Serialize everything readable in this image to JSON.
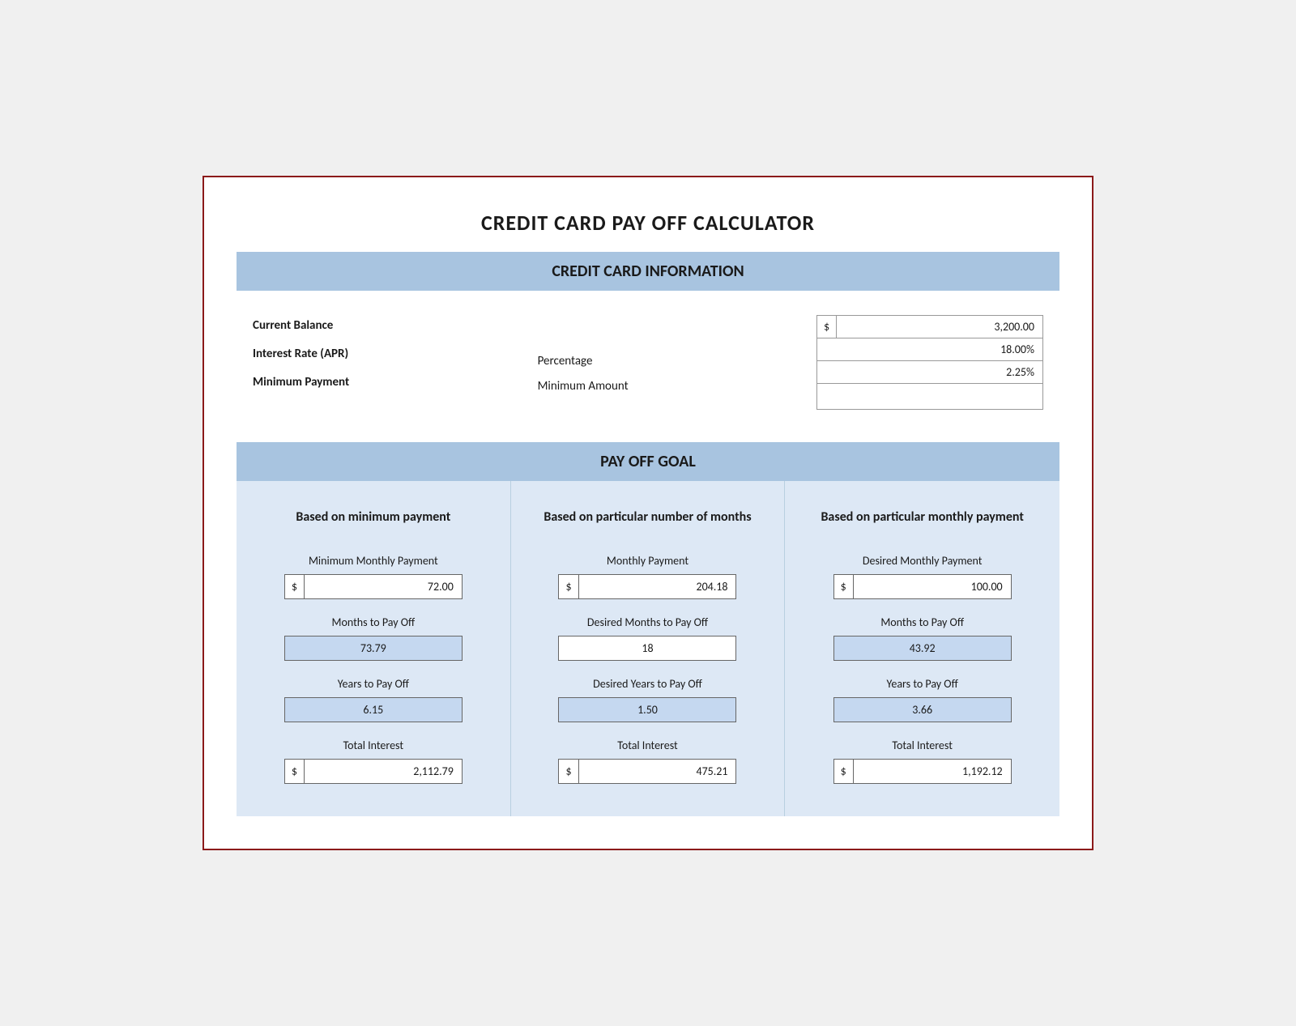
{
  "title": "CREDIT CARD PAY OFF CALCULATOR",
  "sections": {
    "cc_info": {
      "header": "CREDIT CARD INFORMATION",
      "labels": {
        "balance": "Current Balance",
        "interest": "Interest Rate (APR)",
        "minimum": "Minimum Payment"
      },
      "middle": {
        "line1": "Percentage",
        "line2": "Minimum Amount"
      },
      "values": {
        "balance_symbol": "$",
        "balance": "3,200.00",
        "interest": "18.00%",
        "percentage": "2.25%",
        "minimum_amount": ""
      }
    },
    "payoff_goal": {
      "header": "PAY OFF GOAL",
      "col1": {
        "title": "Based on minimum payment",
        "payment_label": "Minimum Monthly Payment",
        "payment_symbol": "$",
        "payment_value": "72.00",
        "months_label": "Months to Pay Off",
        "months_value": "73.79",
        "years_label": "Years to Pay Off",
        "years_value": "6.15",
        "interest_label": "Total Interest",
        "interest_symbol": "$",
        "interest_value": "2,112.79"
      },
      "col2": {
        "title": "Based on particular number of months",
        "payment_label": "Monthly Payment",
        "payment_symbol": "$",
        "payment_value": "204.18",
        "months_label": "Desired Months to Pay Off",
        "months_value": "18",
        "years_label": "Desired Years to Pay Off",
        "years_value": "1.50",
        "interest_label": "Total Interest",
        "interest_symbol": "$",
        "interest_value": "475.21"
      },
      "col3": {
        "title": "Based on particular monthly payment",
        "payment_label": "Desired Monthly Payment",
        "payment_symbol": "$",
        "payment_value": "100.00",
        "months_label": "Months to Pay Off",
        "months_value": "43.92",
        "years_label": "Years to Pay Off",
        "years_value": "3.66",
        "interest_label": "Total Interest",
        "interest_symbol": "$",
        "interest_value": "1,192.12"
      }
    }
  }
}
